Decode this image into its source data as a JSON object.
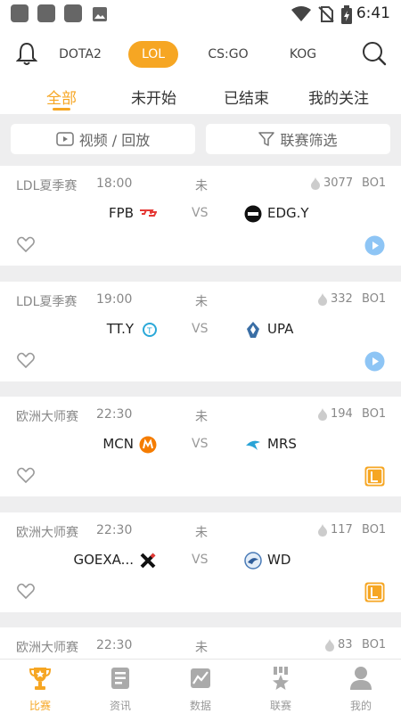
{
  "status_bar": {
    "time": "6:41"
  },
  "game_tabs": [
    {
      "label": "DOTA2",
      "active": false
    },
    {
      "label": "LOL",
      "active": true
    },
    {
      "label": "CS:GO",
      "active": false
    },
    {
      "label": "KOG",
      "active": false
    }
  ],
  "sub_tabs": [
    {
      "label": "全部",
      "active": true
    },
    {
      "label": "未开始",
      "active": false
    },
    {
      "label": "已结束",
      "active": false
    },
    {
      "label": "我的关注",
      "active": false
    }
  ],
  "filters": {
    "video_label": "视频 / 回放",
    "league_label": "联赛筛选"
  },
  "matches": [
    {
      "league": "LDL夏季赛",
      "time": "18:00",
      "status": "未",
      "heat": "3077",
      "format": "BO1",
      "home": "FPB",
      "vs": "VS",
      "away": "EDG.Y",
      "watch_icon": "play-icon"
    },
    {
      "league": "LDL夏季赛",
      "time": "19:00",
      "status": "未",
      "heat": "332",
      "format": "BO1",
      "home": "TT.Y",
      "vs": "VS",
      "away": "UPA",
      "watch_icon": "play-icon"
    },
    {
      "league": "欧洲大师赛",
      "time": "22:30",
      "status": "未",
      "heat": "194",
      "format": "BO1",
      "home": "MCN",
      "vs": "VS",
      "away": "MRS",
      "watch_icon": "lol-stream-icon"
    },
    {
      "league": "欧洲大师赛",
      "time": "22:30",
      "status": "未",
      "heat": "117",
      "format": "BO1",
      "home": "GOEXA...",
      "vs": "VS",
      "away": "WD",
      "watch_icon": "lol-stream-icon"
    },
    {
      "league": "欧洲大师赛",
      "time": "22:30",
      "status": "未",
      "heat": "83",
      "format": "BO1",
      "home": "",
      "vs": "",
      "away": "",
      "watch_icon": ""
    }
  ],
  "bottom_nav": [
    {
      "label": "比赛",
      "active": true,
      "icon": "trophy-icon"
    },
    {
      "label": "资讯",
      "active": false,
      "icon": "news-icon"
    },
    {
      "label": "数据",
      "active": false,
      "icon": "data-icon"
    },
    {
      "label": "联赛",
      "active": false,
      "icon": "league-icon"
    },
    {
      "label": "我的",
      "active": false,
      "icon": "profile-icon"
    }
  ],
  "colors": {
    "accent": "#f6a623",
    "play": "#8ec5f5",
    "lol_stream": "#f6a623"
  }
}
